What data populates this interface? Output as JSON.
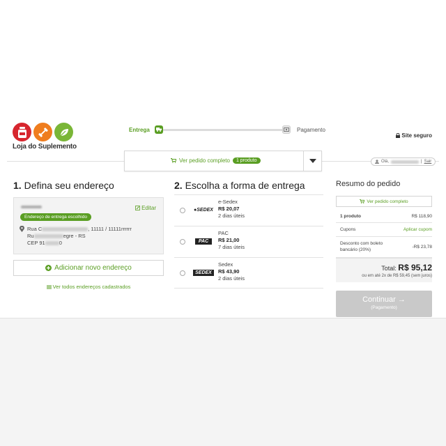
{
  "brand": {
    "name": "Loja do Suplemento",
    "colors": {
      "red": "#d7262e",
      "orange": "#ef7d1e",
      "green": "#7ab637",
      "accent": "#5a9e23"
    }
  },
  "progress": {
    "step1": "Entrega",
    "step2": "Pagamento"
  },
  "header": {
    "secure": "Site seguro",
    "order_link": "Ver pedido completo",
    "order_count": "1 produto"
  },
  "user": {
    "greeting": "Olá,",
    "logout": "Sair"
  },
  "address": {
    "heading_num": "1.",
    "heading": "Defina seu endereço",
    "edit": "Editar",
    "badge": "Endereço de entrega escolhido",
    "line1_a": "Rua C",
    "line1_b": ", 11111 / 11111rrrrrr",
    "line2_a": "Ru",
    "line2_b": "egre - RS",
    "line3_a": "CEP 91",
    "line3_b": "0",
    "add_button": "Adicionar novo endereço",
    "see_all": "Ver todos endereços cadastrados"
  },
  "shipping": {
    "heading_num": "2.",
    "heading": "Escolha a forma de entrega",
    "options": [
      {
        "logo": "SEDEX",
        "name": "e-Sedex",
        "price": "R$ 20,07",
        "time": "2 dias úteis"
      },
      {
        "logo": "PAC",
        "name": "PAC",
        "price": "R$ 21,00",
        "time": "7 dias úteis"
      },
      {
        "logo": "SEDEX",
        "name": "Sedex",
        "price": "R$ 43,90",
        "time": "2 dias úteis"
      }
    ]
  },
  "summary": {
    "title": "Resumo do pedido",
    "order_link": "Ver pedido completo",
    "items_label": "1 produto",
    "items_value": "R$ 118,90",
    "coupons_label": "Cupons",
    "coupons_action": "Aplicar cupom",
    "discount_label": "Desconto com boleto bancário (20%)",
    "discount_value": "-R$ 23,78",
    "total_label": "Total:",
    "total_value": "R$ 95,12",
    "installments": "ou em até 2x de R$ 59,45 (sem juros)",
    "continue_label": "Continuar →",
    "continue_sub": "(Pagamento)"
  }
}
